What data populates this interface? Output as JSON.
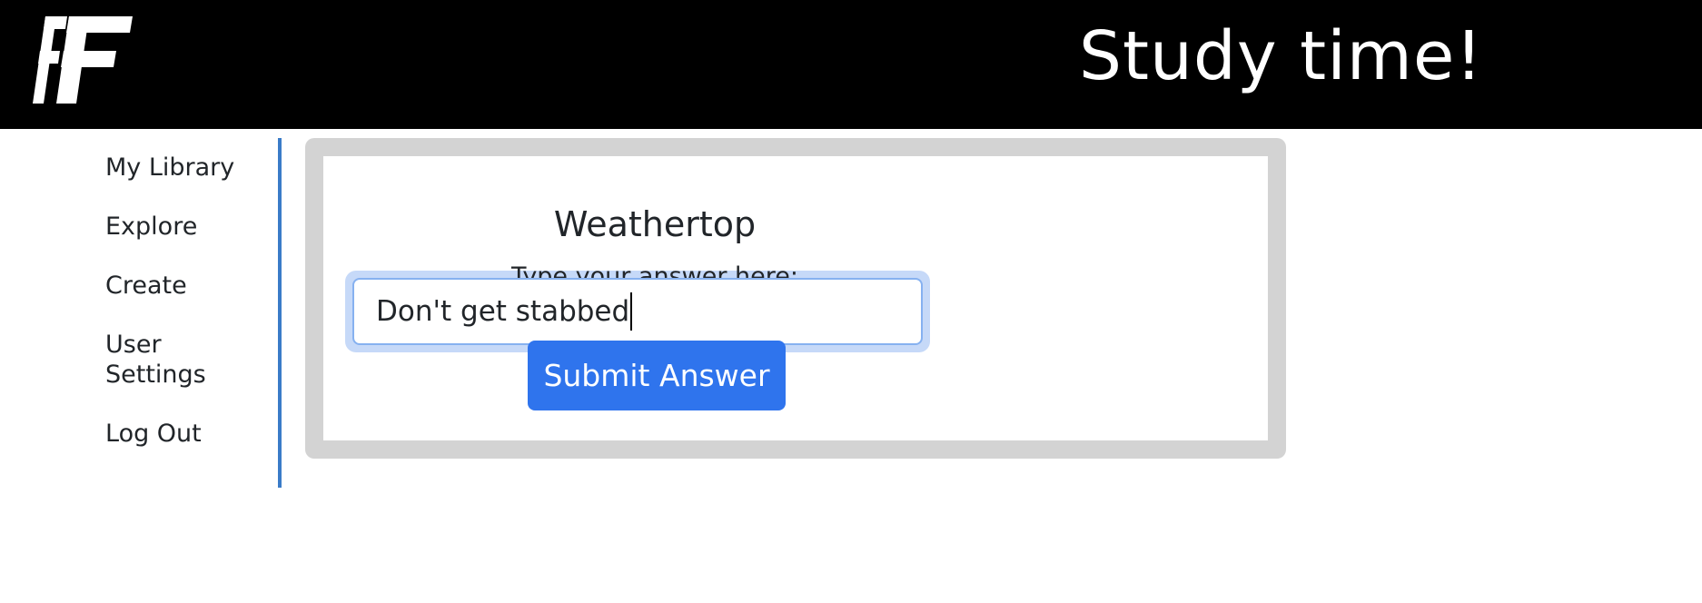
{
  "header": {
    "logo_text": "FF",
    "title": "Study time!"
  },
  "sidebar": {
    "items": [
      {
        "label": "My Library"
      },
      {
        "label": "Explore"
      },
      {
        "label": "Create"
      },
      {
        "label": "User Settings"
      },
      {
        "label": "Log Out"
      }
    ]
  },
  "study": {
    "deck_title": "Weathertop",
    "prompt_label": "Type your answer here:",
    "answer_value": "Don't get stabbed",
    "submit_label": "Submit Answer"
  },
  "colors": {
    "header_background": "#000000",
    "sidebar_border": "#3a7bc8",
    "card_frame": "#d3d3d3",
    "submit_button": "#2f74ed",
    "input_focus_ring": "#c6d9f8"
  }
}
